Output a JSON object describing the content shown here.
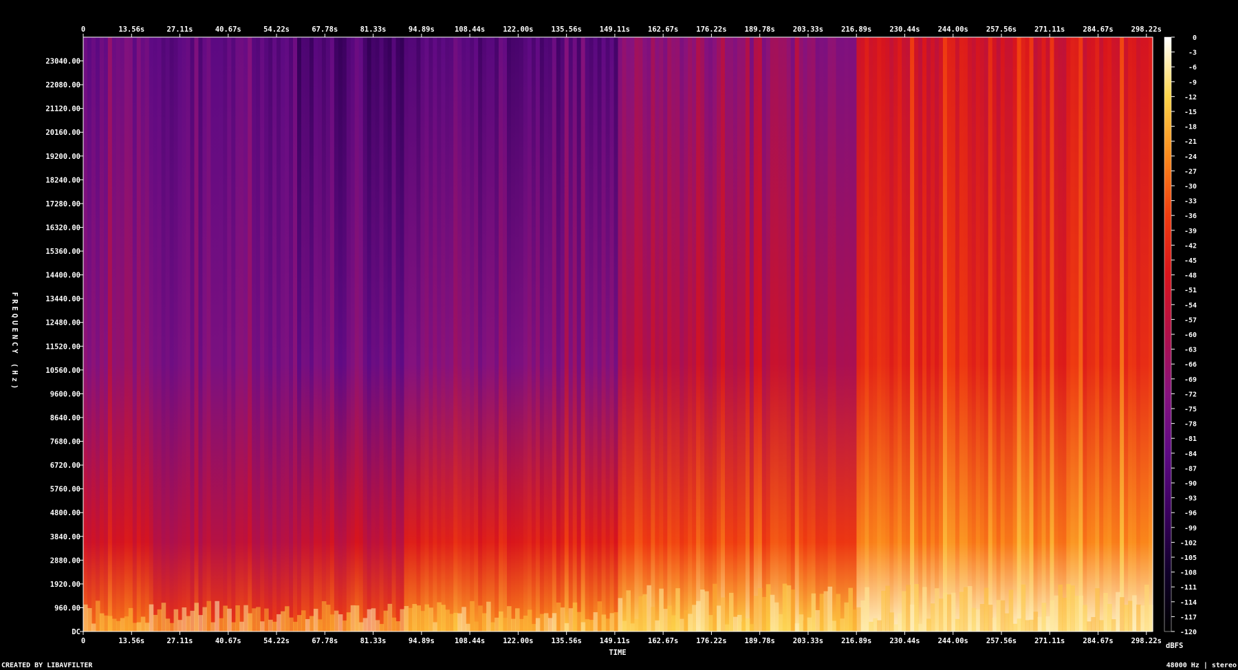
{
  "chart_data": {
    "type": "heatmap",
    "title": "",
    "xlabel": "TIME",
    "ylabel": "FREQUENCY (Hz)",
    "x_ticks": [
      "0",
      "13.56s",
      "27.11s",
      "40.67s",
      "54.22s",
      "67.78s",
      "81.33s",
      "94.89s",
      "108.44s",
      "122.00s",
      "135.56s",
      "149.11s",
      "162.67s",
      "176.22s",
      "189.78s",
      "203.33s",
      "216.89s",
      "230.44s",
      "244.00s",
      "257.56s",
      "271.11s",
      "284.67s",
      "298.22s"
    ],
    "x_tick_values": [
      0,
      13.56,
      27.11,
      40.67,
      54.22,
      67.78,
      81.33,
      94.89,
      108.44,
      122.0,
      135.56,
      149.11,
      162.67,
      176.22,
      189.78,
      203.33,
      216.89,
      230.44,
      244.0,
      257.56,
      271.11,
      284.67,
      298.22
    ],
    "xlim": [
      0,
      300
    ],
    "y_ticks": [
      "DC",
      "960.00",
      "1920.00",
      "2880.00",
      "3840.00",
      "4800.00",
      "5760.00",
      "6720.00",
      "7680.00",
      "8640.00",
      "9600.00",
      "10560.00",
      "11520.00",
      "12480.00",
      "13440.00",
      "14400.00",
      "15360.00",
      "16320.00",
      "17280.00",
      "18240.00",
      "19200.00",
      "20160.00",
      "21120.00",
      "22080.00",
      "23040.00"
    ],
    "y_tick_values": [
      0,
      960,
      1920,
      2880,
      3840,
      4800,
      5760,
      6720,
      7680,
      8640,
      9600,
      10560,
      11520,
      12480,
      13440,
      14400,
      15360,
      16320,
      17280,
      18240,
      19200,
      20160,
      21120,
      22080,
      23040
    ],
    "ylim": [
      0,
      24000
    ],
    "colorbar_label": "dBFS",
    "colorbar_ticks": [
      "0",
      "-3",
      "-6",
      "-9",
      "-12",
      "-15",
      "-18",
      "-21",
      "-24",
      "-27",
      "-30",
      "-33",
      "-36",
      "-39",
      "-42",
      "-45",
      "-48",
      "-51",
      "-54",
      "-57",
      "-60",
      "-63",
      "-66",
      "-69",
      "-72",
      "-75",
      "-78",
      "-81",
      "-84",
      "-87",
      "-90",
      "-93",
      "-96",
      "-99",
      "-102",
      "-105",
      "-108",
      "-111",
      "-114",
      "-117",
      "-120"
    ],
    "colorbar_values": [
      0,
      -3,
      -6,
      -9,
      -12,
      -15,
      -18,
      -21,
      -24,
      -27,
      -30,
      -33,
      -36,
      -39,
      -42,
      -45,
      -48,
      -51,
      -54,
      -57,
      -60,
      -63,
      -66,
      -69,
      -72,
      -75,
      -78,
      -81,
      -84,
      -87,
      -90,
      -93,
      -96,
      -99,
      -102,
      -105,
      -108,
      -111,
      -114,
      -117,
      -120
    ],
    "colormap": [
      "#000000",
      "#10002a",
      "#3a005e",
      "#5e0a84",
      "#86127e",
      "#b0104a",
      "#d8141c",
      "#f03c10",
      "#fb8a1c",
      "#fdd44a",
      "#ffffff"
    ],
    "regions": [
      {
        "t_start": 0,
        "t_end": 20,
        "level_hf": -80,
        "level_lf": -50
      },
      {
        "t_start": 20,
        "t_end": 60,
        "level_hf": -84,
        "level_lf": -58
      },
      {
        "t_start": 60,
        "t_end": 90,
        "level_hf": -92,
        "level_lf": -55
      },
      {
        "t_start": 90,
        "t_end": 150,
        "level_hf": -88,
        "level_lf": -45
      },
      {
        "t_start": 150,
        "t_end": 217,
        "level_hf": -70,
        "level_lf": -35
      },
      {
        "t_start": 217,
        "t_end": 300,
        "level_hf": -50,
        "level_lf": -25
      }
    ]
  },
  "footer": {
    "credit": "CREATED BY LIBAVFILTER",
    "info": "48000 Hz | stereo"
  }
}
